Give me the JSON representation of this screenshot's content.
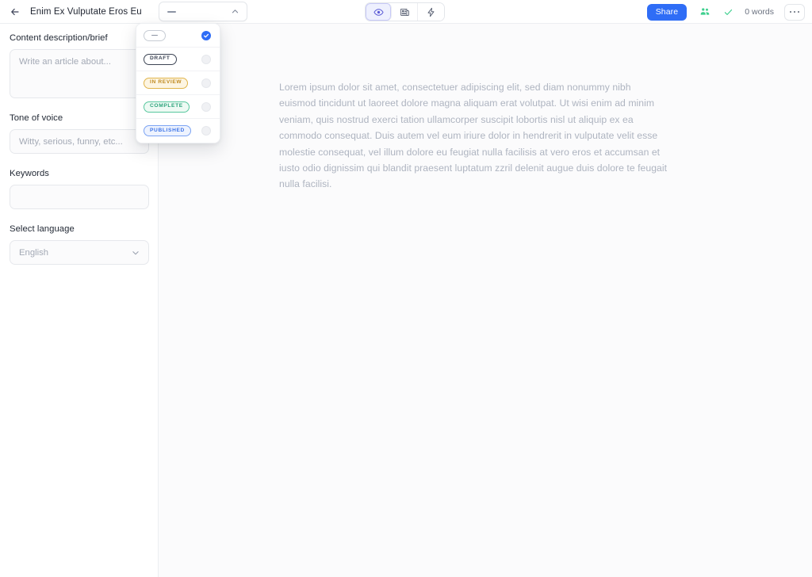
{
  "header": {
    "back_icon": "back-arrow-icon",
    "doc_title": "Enim Ex Vulputate Eros Eu",
    "status_select": {
      "value_dash": "—",
      "chevron_icon": "chevron-up-icon"
    },
    "toolbar": [
      {
        "name": "preview",
        "icon": "eye-icon",
        "active": true
      },
      {
        "name": "article",
        "icon": "newspaper-icon",
        "active": false
      },
      {
        "name": "generate",
        "icon": "lightning-bolt-icon",
        "active": false
      }
    ],
    "share_label": "Share",
    "collab_icon": "people-icon",
    "saved_icon": "check-icon",
    "word_count": "0 words",
    "more_icon": "ellipsis-icon"
  },
  "sidebar": {
    "fields": [
      {
        "label": "Content description/brief",
        "type": "textarea",
        "value": "",
        "placeholder": "Write an article about..."
      },
      {
        "label": "Tone of voice",
        "type": "input",
        "value": "",
        "placeholder": "Witty, serious, funny, etc..."
      },
      {
        "label": "Keywords",
        "type": "input",
        "value": "",
        "placeholder": ""
      },
      {
        "label": "Select language",
        "type": "select",
        "value": "English",
        "placeholder": "English",
        "chevron_icon": "chevron-down-icon"
      }
    ]
  },
  "dropdown": {
    "options": [
      {
        "label": "—",
        "kind": "empty",
        "selected": true,
        "color": "#8b93a3",
        "border": "#c7ccd4",
        "bg": "#ffffff"
      },
      {
        "label": "DRAFT",
        "kind": "badge",
        "selected": false,
        "color": "#3c4454",
        "border": "#3c4454",
        "bg": "#ffffff"
      },
      {
        "label": "IN REVIEW",
        "kind": "badge",
        "selected": false,
        "color": "#c08a21",
        "border": "#e0b44a",
        "bg": "#fdf5e2"
      },
      {
        "label": "COMPLETE",
        "kind": "badge",
        "selected": false,
        "color": "#2aa37a",
        "border": "#58c79e",
        "bg": "#eefaf4"
      },
      {
        "label": "PUBLISHED",
        "kind": "badge",
        "selected": false,
        "color": "#3b73e8",
        "border": "#7ba3f3",
        "bg": "#eef3fe"
      }
    ],
    "check_icon": "check-circle-icon"
  },
  "editor": {
    "placeholder_paragraph": "Lorem ipsum dolor sit amet, consectetuer adipiscing elit, sed diam nonummy nibh euismod tincidunt ut laoreet dolore magna aliquam erat volutpat. Ut wisi enim ad minim veniam, quis nostrud exerci tation ullamcorper suscipit lobortis nisl ut aliquip ex ea commodo consequat. Duis autem vel eum iriure dolor in hendrerit in vulputate velit esse molestie consequat, vel illum dolore eu feugiat nulla facilisis at vero eros et accumsan et iusto odio dignissim qui blandit praesent luptatum zzril delenit augue duis dolore te feugait nulla facilisi."
  },
  "colors": {
    "accent_blue": "#2f6df6",
    "accent_violet": "#5b5bd6",
    "accent_green": "#3ecf8e",
    "canvas": "#fbfbfc",
    "border": "#eceef1"
  }
}
